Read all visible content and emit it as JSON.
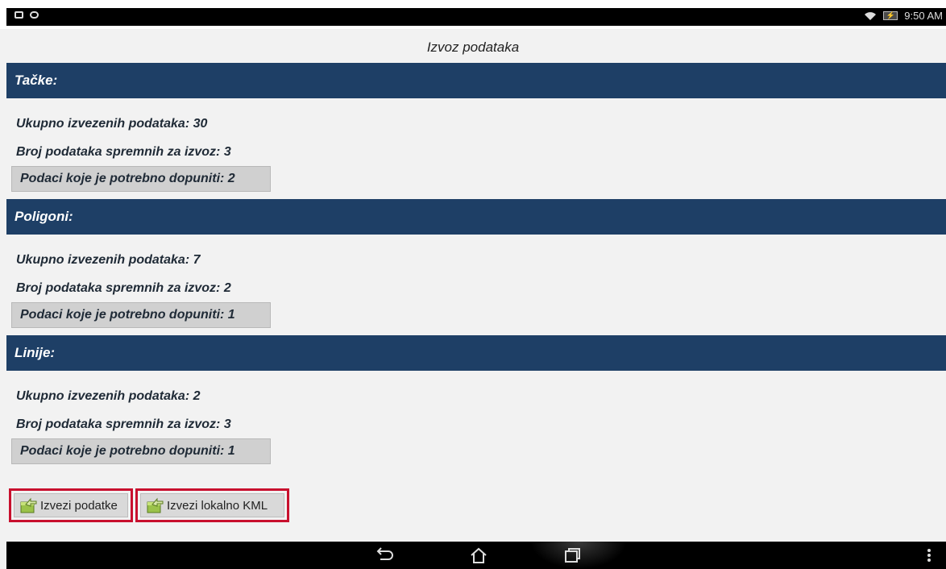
{
  "statusbar": {
    "time": "9:50 AM"
  },
  "title": "Izvoz podataka",
  "sections": [
    {
      "header": "Tačke:",
      "total": "Ukupno izvezenih podataka: 30",
      "ready": "Broj podataka spremnih za izvoz: 3",
      "need": "Podaci koje je potrebno dopuniti: 2"
    },
    {
      "header": "Poligoni:",
      "total": "Ukupno izvezenih podataka: 7",
      "ready": "Broj podataka spremnih za izvoz: 2",
      "need": "Podaci koje je potrebno dopuniti: 1"
    },
    {
      "header": "Linije:",
      "total": "Ukupno izvezenih podataka: 2",
      "ready": "Broj podataka spremnih za izvoz: 3",
      "need": "Podaci koje je potrebno dopuniti: 1"
    }
  ],
  "actions": {
    "export_data": "Izvezi podatke",
    "export_kml": "Izvezi lokalno KML"
  },
  "icons": {
    "export": "export-folder-icon",
    "back": "back-icon",
    "home": "home-icon",
    "recents": "recents-icon",
    "menu": "overflow-menu-icon"
  },
  "colors": {
    "header_bg": "#1e3f66",
    "highlight": "#c8102e"
  }
}
